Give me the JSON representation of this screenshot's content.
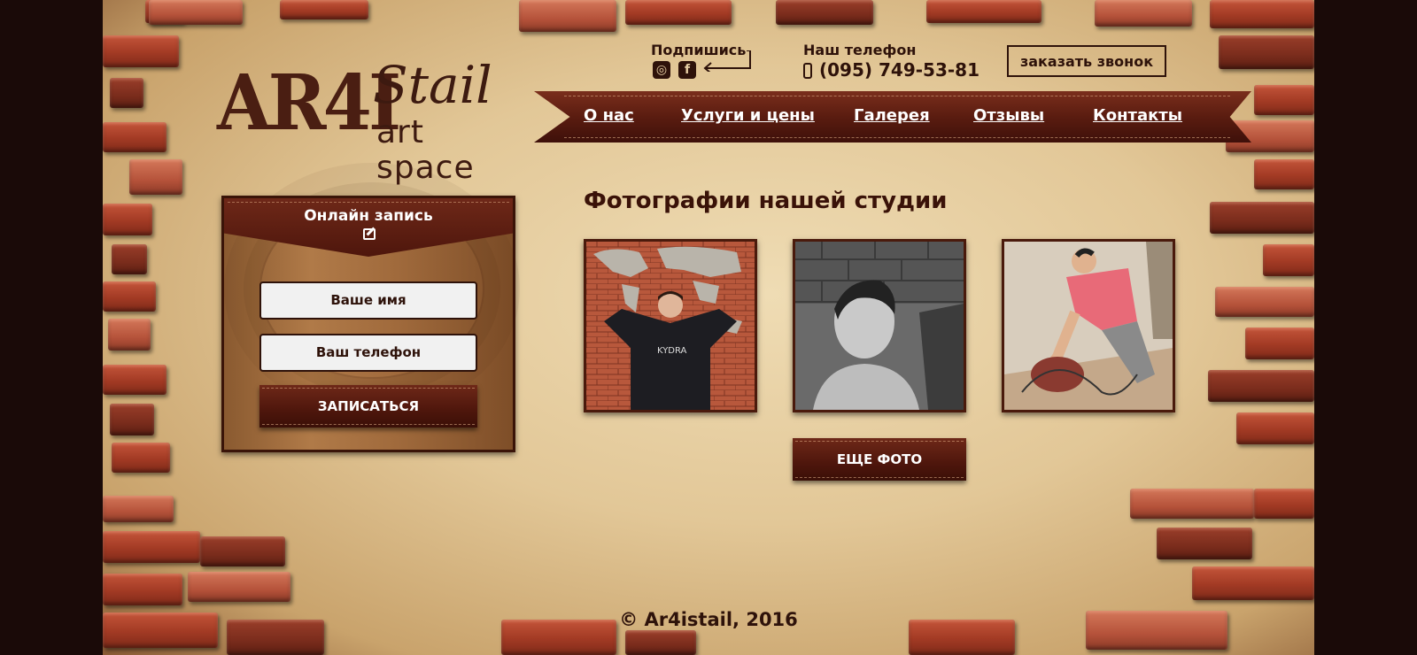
{
  "brand": {
    "logo_main": "AR4I",
    "logo_script": "Stail",
    "logo_sub": "art space"
  },
  "header": {
    "subscribe_label": "Подпишись",
    "social": [
      "instagram-icon",
      "facebook-icon"
    ],
    "phone_label": "Наш телефон",
    "phone_number": "(095) 749-53-81",
    "callback_label": "заказать звонок"
  },
  "nav": {
    "items": [
      "О нас",
      "Услуги и цены",
      "Галерея",
      "Отзывы",
      "Контакты"
    ]
  },
  "booking": {
    "title": "Онлайн запись",
    "icon": "edit-icon",
    "name_placeholder": "Ваше имя",
    "phone_placeholder": "Ваш телефон",
    "submit_label": "ЗАПИСАТЬСЯ"
  },
  "gallery": {
    "title": "Фотографии нашей студии",
    "more_label": "ЕЩЕ ФОТО",
    "photo1_text": "KYDRA"
  },
  "footer": {
    "copyright": "© Ar4istail, 2016"
  },
  "colors": {
    "brown_dark": "#2e120a",
    "leather": "#5a1c10",
    "parchment": "#e2c797"
  }
}
